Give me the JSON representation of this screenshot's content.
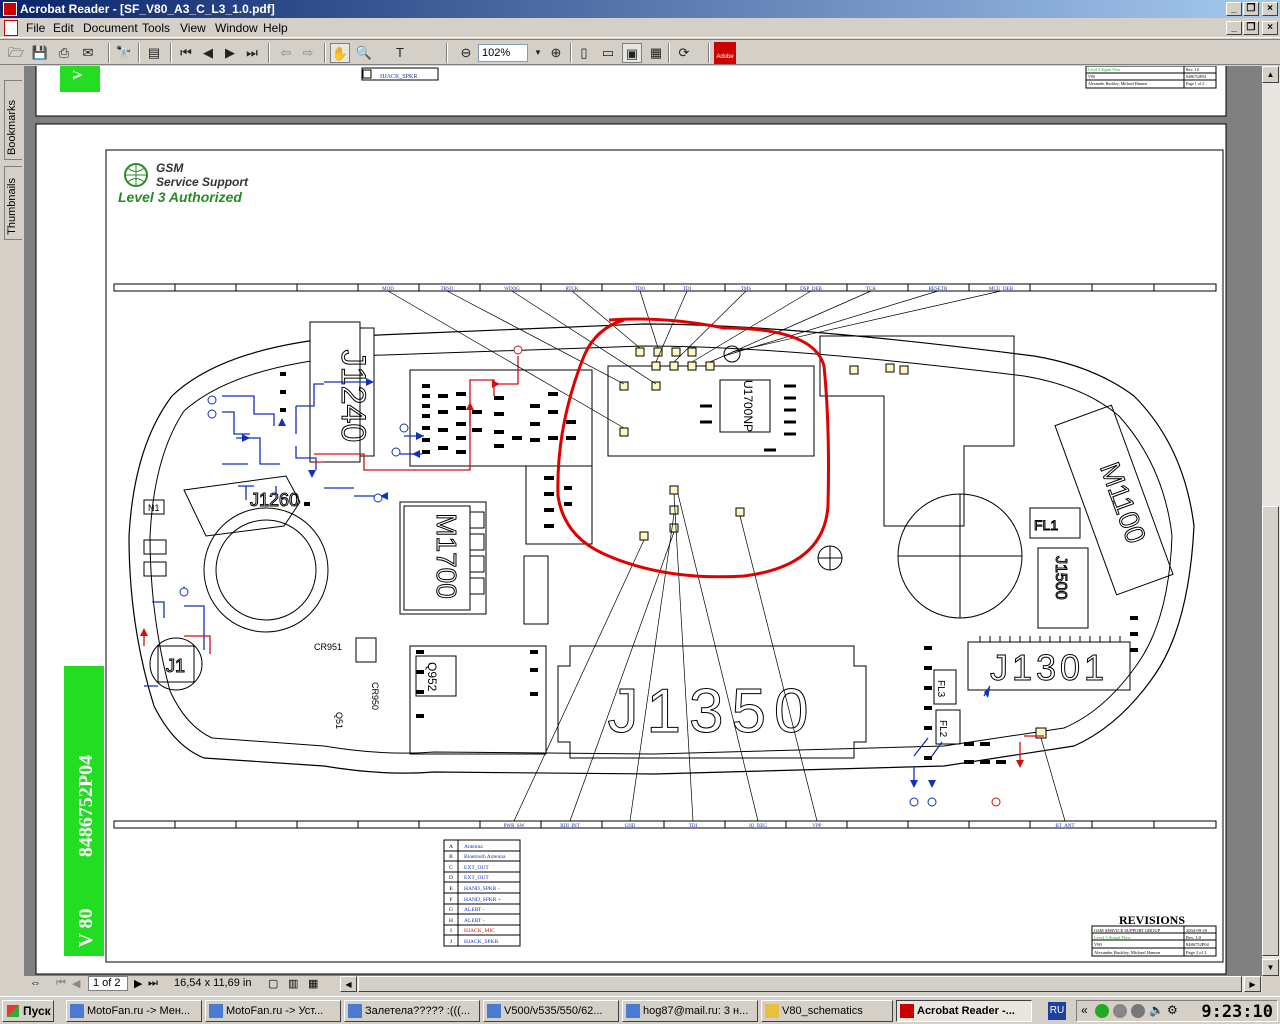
{
  "window": {
    "title": "Acrobat Reader - [SF_V80_A3_C_L3_1.0.pdf]"
  },
  "menu": [
    "File",
    "Edit",
    "Document",
    "Tools",
    "View",
    "Window",
    "Help"
  ],
  "toolbar": {
    "zoom": "102%"
  },
  "sidebar": {
    "bookmarks": "Bookmarks",
    "thumbnails": "Thumbnails"
  },
  "status": {
    "page": "1 of 2",
    "size": "16,54 x 11,69 in"
  },
  "doc": {
    "logo_line1": "GSM",
    "logo_line2": "Service Support",
    "logo_line3": "Level 3 Authorized",
    "part_number": "8486752P04",
    "model": "V 80",
    "top_labels": [
      "MOD",
      "TRSO",
      "WDOG",
      "RTCK",
      "TDO",
      "TDI",
      "TMS",
      "DSP_DEB",
      "TCK",
      "RESETB",
      "MCU_DEB"
    ],
    "bottom_labels": [
      "PWR_SW",
      "RDI_INT",
      "GND",
      "TDI",
      "IO_REG",
      "VPP",
      "BT_ANT"
    ],
    "components": [
      "J1240",
      "J1260",
      "M1700",
      "Q952",
      "J1350",
      "J1301",
      "J1500",
      "FL1",
      "FL2",
      "FL3",
      "M1100",
      "N1",
      "J1",
      "U1700NP",
      "CR951",
      "CR950",
      "Q51"
    ],
    "legend": [
      {
        "key": "A",
        "text": "Antenna"
      },
      {
        "key": "B",
        "text": "Bluetooth Antenna"
      },
      {
        "key": "C",
        "text": "EXT_OUT"
      },
      {
        "key": "D",
        "text": "EXT_OUT"
      },
      {
        "key": "E",
        "text": "HAND_SPKR -"
      },
      {
        "key": "F",
        "text": "HAND_SPKR +"
      },
      {
        "key": "G",
        "text": "ALERT -"
      },
      {
        "key": "H",
        "text": "ALERT -"
      },
      {
        "key": "I",
        "text": "HJACK_MIC"
      },
      {
        "key": "J",
        "text": "HJACK_SPKR"
      }
    ],
    "prev_legend_last": "HJACK_SPKR",
    "revisions_title": "REVISIONS",
    "revisions": [
      [
        "GSM SERVICE SUPPORT GROUP",
        "2004-09-29"
      ],
      [
        "Level 3 Signal Flow",
        "Rev. 1.0"
      ],
      [
        "V80",
        "8486752P04"
      ],
      [
        "Alexander Buckley, Michael Hansen",
        "Page 2 of 2"
      ]
    ],
    "prev_revisions": [
      [
        "Level 3 Signal Flow",
        "Rev. 1.0"
      ],
      [
        "V80",
        "8486752P04"
      ],
      [
        "Alexander Buckley, Michael Hansen",
        "Page 1 of 2"
      ]
    ]
  },
  "taskbar": {
    "start": "Пуск",
    "tasks": [
      "MotoFan.ru -> Мен...",
      "MotoFan.ru -> Уст...",
      "Залетела????? :(((...",
      "V500/v535/550/62...",
      "hog87@mail.ru: 3 н...",
      "V80_schematics",
      "Acrobat Reader -..."
    ],
    "lang": "RU",
    "clock": "9:23:10"
  },
  "colors": {
    "accent": "#0a246a",
    "red_circle": "#e00000",
    "signal_blue": "#1030c0",
    "signal_red": "#d01010",
    "green_band": "#22dd22"
  }
}
